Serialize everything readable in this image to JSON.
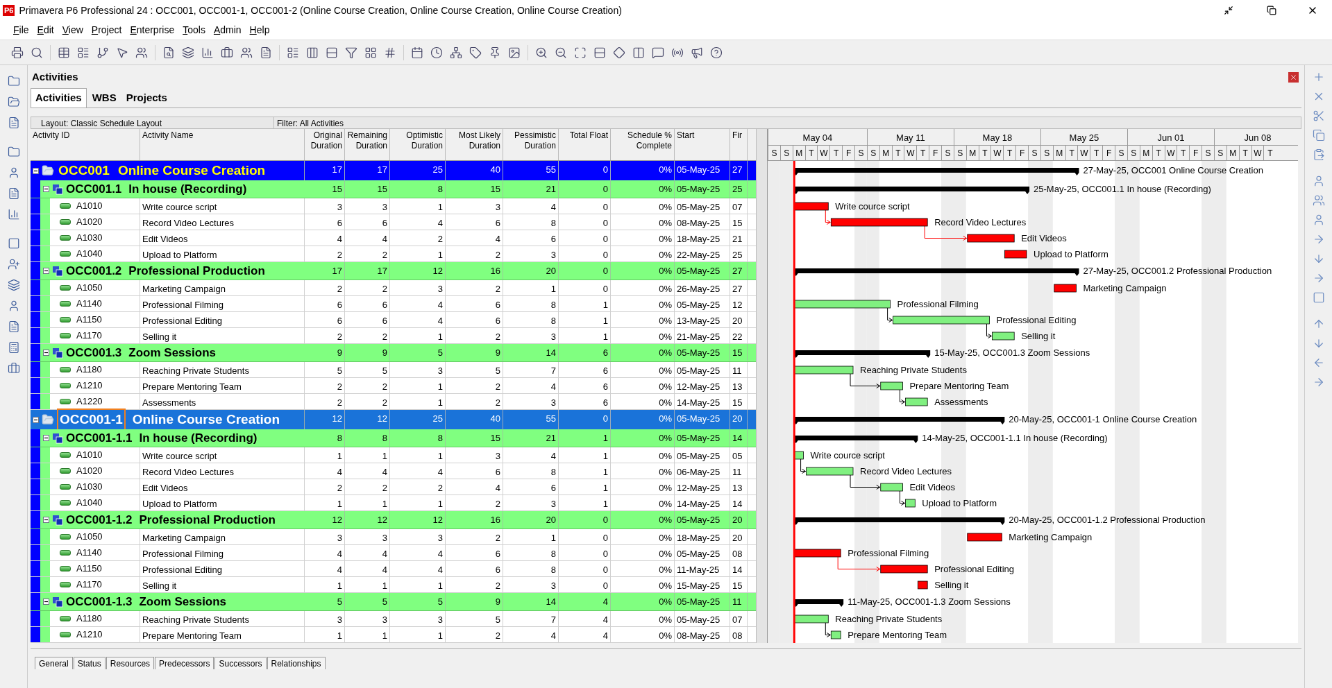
{
  "window": {
    "logo": "P6",
    "title": "Primavera P6 Professional 24 : OCC001, OCC001-1, OCC001-2 (Online Course Creation, Online Course Creation, Online Course Creation)"
  },
  "menu": [
    "File",
    "Edit",
    "View",
    "Project",
    "Enterprise",
    "Tools",
    "Admin",
    "Help"
  ],
  "panel": {
    "title": "Activities"
  },
  "tabs": [
    {
      "label": "Activities",
      "selected": true
    },
    {
      "label": "WBS",
      "selected": false
    },
    {
      "label": "Projects",
      "selected": false
    }
  ],
  "layout_bar": {
    "layout": "Layout: Classic Schedule Layout",
    "filter": "Filter: All Activities"
  },
  "columns": [
    "Activity ID",
    "Activity Name",
    "Original Duration",
    "Remaining Duration",
    "Optimistic Duration",
    "Most Likely Duration",
    "Pessimistic Duration",
    "Total Float",
    "Schedule % Complete",
    "Start",
    "Fir"
  ],
  "timescale": {
    "months": [
      "May 04",
      "May 11",
      "May 18",
      "May 25",
      "Jun 01",
      "Jun 08"
    ],
    "days": [
      "S",
      "S",
      "M",
      "T",
      "W",
      "T",
      "F",
      "S",
      "S",
      "M",
      "T",
      "W",
      "T",
      "F",
      "S",
      "S",
      "M",
      "T",
      "W",
      "T",
      "F",
      "S",
      "S",
      "M",
      "T",
      "W",
      "T",
      "F",
      "S",
      "S",
      "M",
      "T",
      "W",
      "T",
      "F",
      "S",
      "S",
      "M",
      "T",
      "W",
      "T"
    ]
  },
  "projects": [
    {
      "id": "OCC001",
      "name": "Online Course Creation",
      "selected": false,
      "expanded": true,
      "values": [
        "17",
        "17",
        "25",
        "40",
        "55",
        "0",
        "0%",
        "05-May-25",
        "27"
      ],
      "bar_label": "27-May-25, OCC001  Online Course Creation",
      "wbs": [
        {
          "id": "OCC001.1",
          "name": "In house (Recording)",
          "expanded": true,
          "values": [
            "15",
            "15",
            "8",
            "15",
            "21",
            "0",
            "0%",
            "05-May-25",
            "25"
          ],
          "bar_label": "25-May-25, OCC001.1  In house (Recording)",
          "activities": [
            {
              "id": "A1010",
              "name": "Write cource script",
              "critical": true,
              "values": [
                "3",
                "3",
                "1",
                "3",
                "4",
                "0",
                "0%",
                "05-May-25",
                "07"
              ],
              "bar_label": "Write cource script"
            },
            {
              "id": "A1020",
              "name": "Record Video Lectures",
              "critical": true,
              "values": [
                "6",
                "6",
                "4",
                "6",
                "8",
                "0",
                "0%",
                "08-May-25",
                "15"
              ],
              "bar_label": "Record Video Lectures"
            },
            {
              "id": "A1030",
              "name": "Edit Videos",
              "critical": true,
              "values": [
                "4",
                "4",
                "2",
                "4",
                "6",
                "0",
                "0%",
                "18-May-25",
                "21"
              ],
              "bar_label": "Edit Videos"
            },
            {
              "id": "A1040",
              "name": "Upload to Platform",
              "critical": true,
              "values": [
                "2",
                "2",
                "1",
                "2",
                "3",
                "0",
                "0%",
                "22-May-25",
                "25"
              ],
              "bar_label": "Upload to Platform"
            }
          ]
        },
        {
          "id": "OCC001.2",
          "name": "Professional Production",
          "expanded": true,
          "values": [
            "17",
            "17",
            "12",
            "16",
            "20",
            "0",
            "0%",
            "05-May-25",
            "27"
          ],
          "bar_label": "27-May-25, OCC001.2  Professional Production",
          "activities": [
            {
              "id": "A1050",
              "name": "Marketing Campaign",
              "critical": true,
              "values": [
                "2",
                "2",
                "3",
                "2",
                "1",
                "0",
                "0%",
                "26-May-25",
                "27"
              ],
              "bar_label": "Marketing Campaign"
            },
            {
              "id": "A1140",
              "name": "Professional Filming",
              "critical": false,
              "values": [
                "6",
                "6",
                "4",
                "6",
                "8",
                "1",
                "0%",
                "05-May-25",
                "12"
              ],
              "bar_label": "Professional Filming"
            },
            {
              "id": "A1150",
              "name": "Professional Editing",
              "critical": false,
              "values": [
                "6",
                "6",
                "4",
                "6",
                "8",
                "1",
                "0%",
                "13-May-25",
                "20"
              ],
              "bar_label": "Professional Editing"
            },
            {
              "id": "A1170",
              "name": "Selling it",
              "critical": false,
              "values": [
                "2",
                "2",
                "1",
                "2",
                "3",
                "1",
                "0%",
                "21-May-25",
                "22"
              ],
              "bar_label": "Selling it"
            }
          ]
        },
        {
          "id": "OCC001.3",
          "name": "Zoom Sessions",
          "expanded": true,
          "values": [
            "9",
            "9",
            "5",
            "9",
            "14",
            "6",
            "0%",
            "05-May-25",
            "15"
          ],
          "bar_label": "15-May-25, OCC001.3  Zoom Sessions",
          "activities": [
            {
              "id": "A1180",
              "name": "Reaching Private Students",
              "critical": false,
              "values": [
                "5",
                "5",
                "3",
                "5",
                "7",
                "6",
                "0%",
                "05-May-25",
                "11"
              ],
              "bar_label": "Reaching Private Students"
            },
            {
              "id": "A1210",
              "name": "Prepare Mentoring Team",
              "critical": false,
              "values": [
                "2",
                "2",
                "1",
                "2",
                "4",
                "6",
                "0%",
                "12-May-25",
                "13"
              ],
              "bar_label": "Prepare Mentoring Team"
            },
            {
              "id": "A1220",
              "name": "Assessments",
              "critical": false,
              "values": [
                "2",
                "2",
                "1",
                "2",
                "3",
                "6",
                "0%",
                "14-May-25",
                "15"
              ],
              "bar_label": "Assessments"
            }
          ]
        }
      ]
    },
    {
      "id": "OCC001-1",
      "name": "Online Course Creation",
      "selected": true,
      "expanded": true,
      "values": [
        "12",
        "12",
        "25",
        "40",
        "55",
        "0",
        "0%",
        "05-May-25",
        "20"
      ],
      "bar_label": "20-May-25, OCC001-1  Online Course Creation",
      "wbs": [
        {
          "id": "OCC001-1.1",
          "name": "In house (Recording)",
          "expanded": true,
          "values": [
            "8",
            "8",
            "8",
            "15",
            "21",
            "1",
            "0%",
            "05-May-25",
            "14"
          ],
          "bar_label": "14-May-25, OCC001-1.1  In house (Recording)",
          "activities": [
            {
              "id": "A1010",
              "name": "Write cource script",
              "critical": false,
              "values": [
                "1",
                "1",
                "1",
                "3",
                "4",
                "1",
                "0%",
                "05-May-25",
                "05"
              ],
              "bar_label": "Write cource script"
            },
            {
              "id": "A1020",
              "name": "Record Video Lectures",
              "critical": false,
              "values": [
                "4",
                "4",
                "4",
                "6",
                "8",
                "1",
                "0%",
                "06-May-25",
                "11"
              ],
              "bar_label": "Record Video Lectures"
            },
            {
              "id": "A1030",
              "name": "Edit Videos",
              "critical": false,
              "values": [
                "2",
                "2",
                "2",
                "4",
                "6",
                "1",
                "0%",
                "12-May-25",
                "13"
              ],
              "bar_label": "Edit Videos"
            },
            {
              "id": "A1040",
              "name": "Upload to Platform",
              "critical": false,
              "values": [
                "1",
                "1",
                "1",
                "2",
                "3",
                "1",
                "0%",
                "14-May-25",
                "14"
              ],
              "bar_label": "Upload to Platform"
            }
          ]
        },
        {
          "id": "OCC001-1.2",
          "name": "Professional Production",
          "expanded": true,
          "values": [
            "12",
            "12",
            "12",
            "16",
            "20",
            "0",
            "0%",
            "05-May-25",
            "20"
          ],
          "bar_label": "20-May-25, OCC001-1.2  Professional Production",
          "activities": [
            {
              "id": "A1050",
              "name": "Marketing Campaign",
              "critical": true,
              "values": [
                "3",
                "3",
                "3",
                "2",
                "1",
                "0",
                "0%",
                "18-May-25",
                "20"
              ],
              "bar_label": "Marketing Campaign"
            },
            {
              "id": "A1140",
              "name": "Professional Filming",
              "critical": true,
              "values": [
                "4",
                "4",
                "4",
                "6",
                "8",
                "0",
                "0%",
                "05-May-25",
                "08"
              ],
              "bar_label": "Professional Filming"
            },
            {
              "id": "A1150",
              "name": "Professional Editing",
              "critical": true,
              "values": [
                "4",
                "4",
                "4",
                "6",
                "8",
                "0",
                "0%",
                "11-May-25",
                "14"
              ],
              "bar_label": "Professional Editing"
            },
            {
              "id": "A1170",
              "name": "Selling it",
              "critical": true,
              "values": [
                "1",
                "1",
                "1",
                "2",
                "3",
                "0",
                "0%",
                "15-May-25",
                "15"
              ],
              "bar_label": "Selling it"
            }
          ]
        },
        {
          "id": "OCC001-1.3",
          "name": "Zoom Sessions",
          "expanded": true,
          "values": [
            "5",
            "5",
            "5",
            "9",
            "14",
            "4",
            "0%",
            "05-May-25",
            "11"
          ],
          "bar_label": "11-May-25, OCC001-1.3  Zoom Sessions",
          "activities": [
            {
              "id": "A1180",
              "name": "Reaching Private Students",
              "critical": false,
              "values": [
                "3",
                "3",
                "3",
                "5",
                "7",
                "4",
                "0%",
                "05-May-25",
                "07"
              ],
              "bar_label": "Reaching Private Students"
            },
            {
              "id": "A1210",
              "name": "Prepare Mentoring Team",
              "critical": false,
              "values": [
                "1",
                "1",
                "1",
                "2",
                "4",
                "4",
                "0%",
                "08-May-25",
                "08"
              ],
              "bar_label": "Prepare Mentoring Team"
            }
          ]
        }
      ]
    }
  ],
  "detail_tabs": [
    "General",
    "Status",
    "Resources",
    "Predecessors",
    "Successors",
    "Relationships"
  ]
}
